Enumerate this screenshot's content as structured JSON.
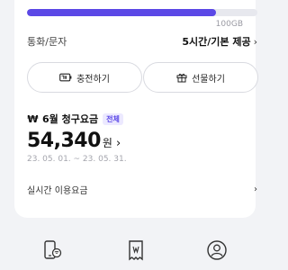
{
  "data_usage": {
    "used_fraction": 0.82,
    "cap_label": "100GB"
  },
  "call": {
    "label": "통화/문자",
    "value": "5시간/기본 제공",
    "chevron": "›"
  },
  "buttons": {
    "charge_label": "충전하기",
    "charge_icon": "battery-charge-icon",
    "gift_label": "선물하기",
    "gift_icon": "gift-icon"
  },
  "bill": {
    "icon": "won-icon",
    "icon_glyph": "₩",
    "title": "6월 청구요금",
    "badge": "전체",
    "amount": "54,340",
    "unit": "원",
    "chevron": "›",
    "period": "23. 05. 01. ~ 23. 05. 31."
  },
  "realtime": {
    "label": "실시간 이용요금",
    "chevron": "›"
  },
  "bottom_nav": [
    {
      "icon": "phone-wifi-icon"
    },
    {
      "icon": "receipt-icon"
    },
    {
      "icon": "user-icon"
    }
  ],
  "colors": {
    "accent": "#5b48e6",
    "background": "#f2f3f6",
    "card": "#ffffff",
    "badge_bg": "#ece9ff"
  }
}
